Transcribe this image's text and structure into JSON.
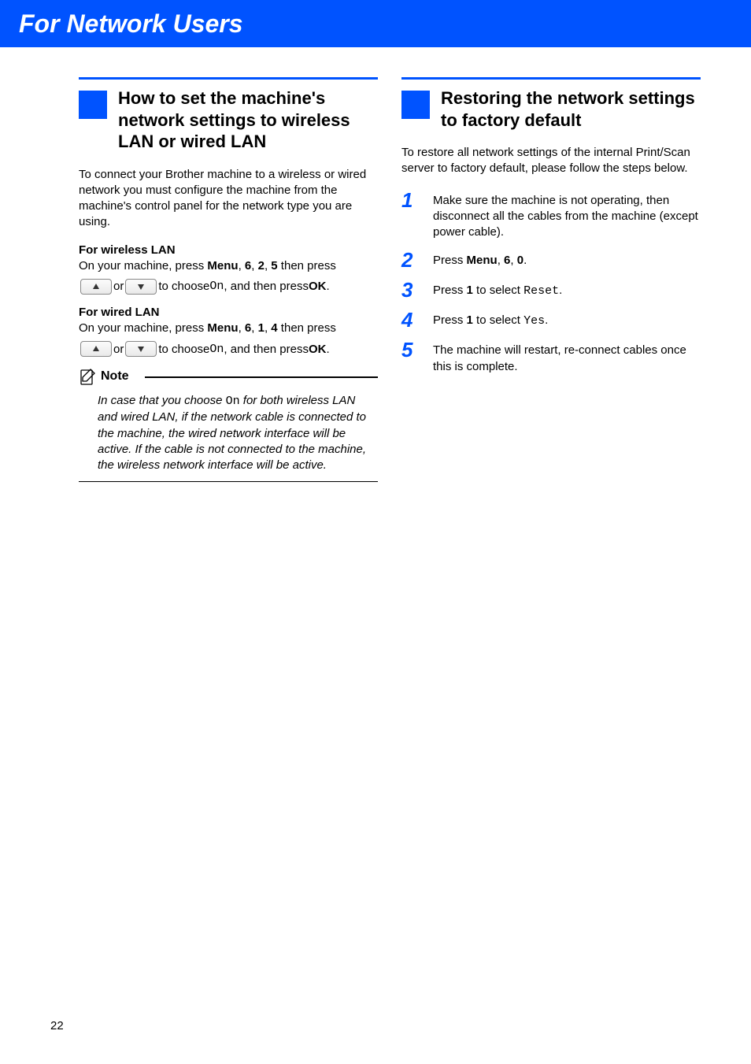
{
  "banner": {
    "title": "For Network Users"
  },
  "left": {
    "section_title": "How to set the machine's network settings to wireless LAN or wired LAN",
    "intro": "To connect your Brother machine to a wireless or wired network you must configure the machine from the machine's control panel for the network type you are using.",
    "wireless": {
      "head": "For wireless LAN",
      "line_pre": "On your machine, press ",
      "menu": "Menu",
      "c": ", ",
      "k1": "6",
      "k2": "2",
      "k3": "5",
      "tail": " then press",
      "row_or": " or ",
      "row_choose_pre": " to choose ",
      "row_choose_code": "On",
      "row_choose_post": ", and then press ",
      "row_ok": "OK",
      "row_period": "."
    },
    "wired": {
      "head": "For wired LAN",
      "line_pre": "On your machine, press ",
      "menu": "Menu",
      "c": ", ",
      "k1": "6",
      "k2": "1",
      "k3": "4",
      "tail": " then press",
      "row_or": " or ",
      "row_choose_pre": " to choose ",
      "row_choose_code": "On",
      "row_choose_post": ", and then press ",
      "row_ok": "OK",
      "row_period": "."
    },
    "note": {
      "label": "Note",
      "body_pre": "In case that you choose ",
      "body_code": "On",
      "body_post": " for both wireless LAN and wired LAN, if the network cable is connected to the machine, the wired network interface will be active. If the cable is not connected to the machine, the wireless network interface will be active."
    }
  },
  "right": {
    "section_title": "Restoring the network settings to factory default",
    "intro": "To restore all network settings of the internal Print/Scan server to factory default, please follow the steps below.",
    "steps": {
      "1": "Make sure the machine is not operating, then disconnect all the cables from the machine (except power cable).",
      "2": {
        "pre": "Press ",
        "menu": "Menu",
        "c": ", ",
        "k1": "6",
        "k2": "0",
        "period": "."
      },
      "3": {
        "pre": "Press ",
        "one": "1",
        "mid": " to select ",
        "code": "Reset",
        "period": "."
      },
      "4": {
        "pre": "Press ",
        "one": "1",
        "mid": " to select ",
        "code": "Yes",
        "period": "."
      },
      "5": "The machine will restart, re-connect cables once this is complete."
    }
  },
  "page_number": "22"
}
